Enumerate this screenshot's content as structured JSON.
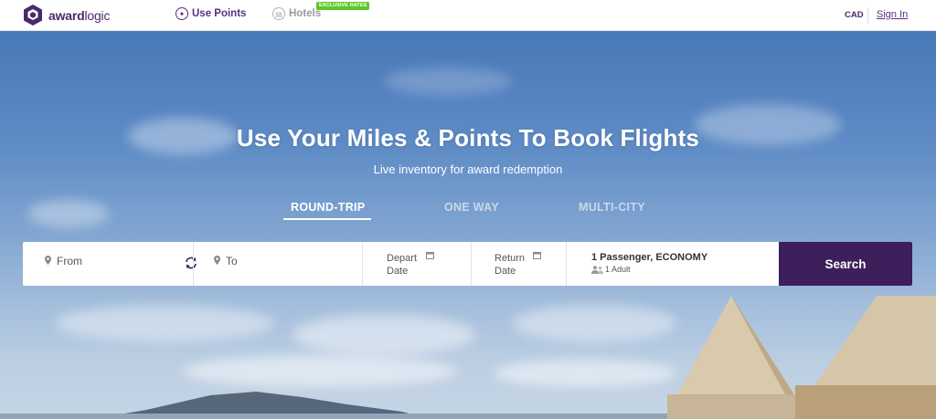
{
  "brand": {
    "name_bold": "award",
    "name_light": "logic"
  },
  "nav": {
    "use_points": "Use Points",
    "hotels": "Hotels",
    "hotels_badge": "EXCLUSIVE RATES",
    "currency": "CAD",
    "sign_in": "Sign In"
  },
  "hero": {
    "title": "Use Your Miles & Points To Book Flights",
    "subtitle": "Live inventory for award redemption"
  },
  "trip_tabs": [
    {
      "label": "ROUND-TRIP",
      "active": true
    },
    {
      "label": "ONE WAY",
      "active": false
    },
    {
      "label": "MULTI-CITY",
      "active": false
    }
  ],
  "search": {
    "from_placeholder": "From",
    "to_placeholder": "To",
    "depart_label": "Depart Date",
    "return_label": "Return Date",
    "passengers_summary": "1 Passenger, ECONOMY",
    "passengers_detail": "1 Adult",
    "button_label": "Search"
  },
  "icons": {
    "logo": "cube-logo-icon",
    "use_points": "points-icon",
    "hotels": "hotel-icon",
    "from": "map-pin-icon",
    "swap": "swap-arrows-icon",
    "to": "map-pin-icon",
    "calendar": "calendar-icon",
    "passengers": "people-icon"
  },
  "colors": {
    "brand": "#4a2a6b",
    "accent": "#5a2f82",
    "search_button": "#3d1f5c",
    "badge": "#5ec72a"
  }
}
